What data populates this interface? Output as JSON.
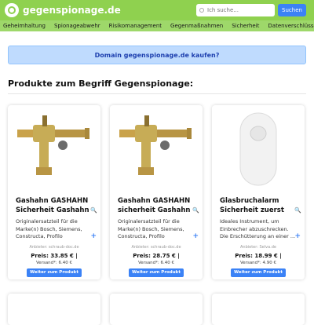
{
  "site": {
    "name": "gegenspionage.de"
  },
  "search": {
    "placeholder": "Ich suche...",
    "button_label": "Suchen"
  },
  "nav": {
    "items": [
      "Geheimhaltung",
      "Spionageabwehr",
      "Risikomanagement",
      "Gegenmaßnahmen",
      "Sicherheit",
      "Datenverschlüsselung"
    ]
  },
  "banner": {
    "text": "Domain gegenspionage.de kaufen?"
  },
  "section": {
    "title": "Produkte zum Begriff Gegenspionage:"
  },
  "products": [
    {
      "title": "Gashahn GASHAHN Sicherheit Gashahn ...",
      "desc": "Originalersatzteil für die Marke(n) Bosch, Siemens, Constructa, Profilo",
      "seller": "Anbieter: schraub-doc.de",
      "price": "Preis: 33.85 € |",
      "shipping": "Versand*: 6.40 €",
      "button": "Weiter zum Produkt"
    },
    {
      "title": "Gashahn GASHAHN sicherheit Gashahn ...",
      "desc": "Originalersatzteil für die Marke(n) Bosch, Siemens, Constructa, Profilo",
      "seller": "Anbieter: schraub-doc.de",
      "price": "Preis: 28.75 € |",
      "shipping": "Versand*: 6.40 €",
      "button": "Weiter zum Produkt"
    },
    {
      "title": "Glasbruchalarm Sicherheit zuerst",
      "desc": "Ideales Instrument, um Einbrecher abzuschrecken. Die Erschütterung an einer ...",
      "seller": "Anbieter: Selva.de",
      "price": "Preis: 18.99 € |",
      "shipping": "Versand*: 4.90 €",
      "button": "Weiter zum Produkt"
    }
  ],
  "icons": {
    "magnifier": "search-icon",
    "plus": "plus-icon"
  },
  "colors": {
    "header": "#8fd14f",
    "nav": "#9ed86a",
    "accent": "#3b82f6",
    "banner_bg": "#bfdbfe",
    "banner_text": "#1e40af"
  }
}
